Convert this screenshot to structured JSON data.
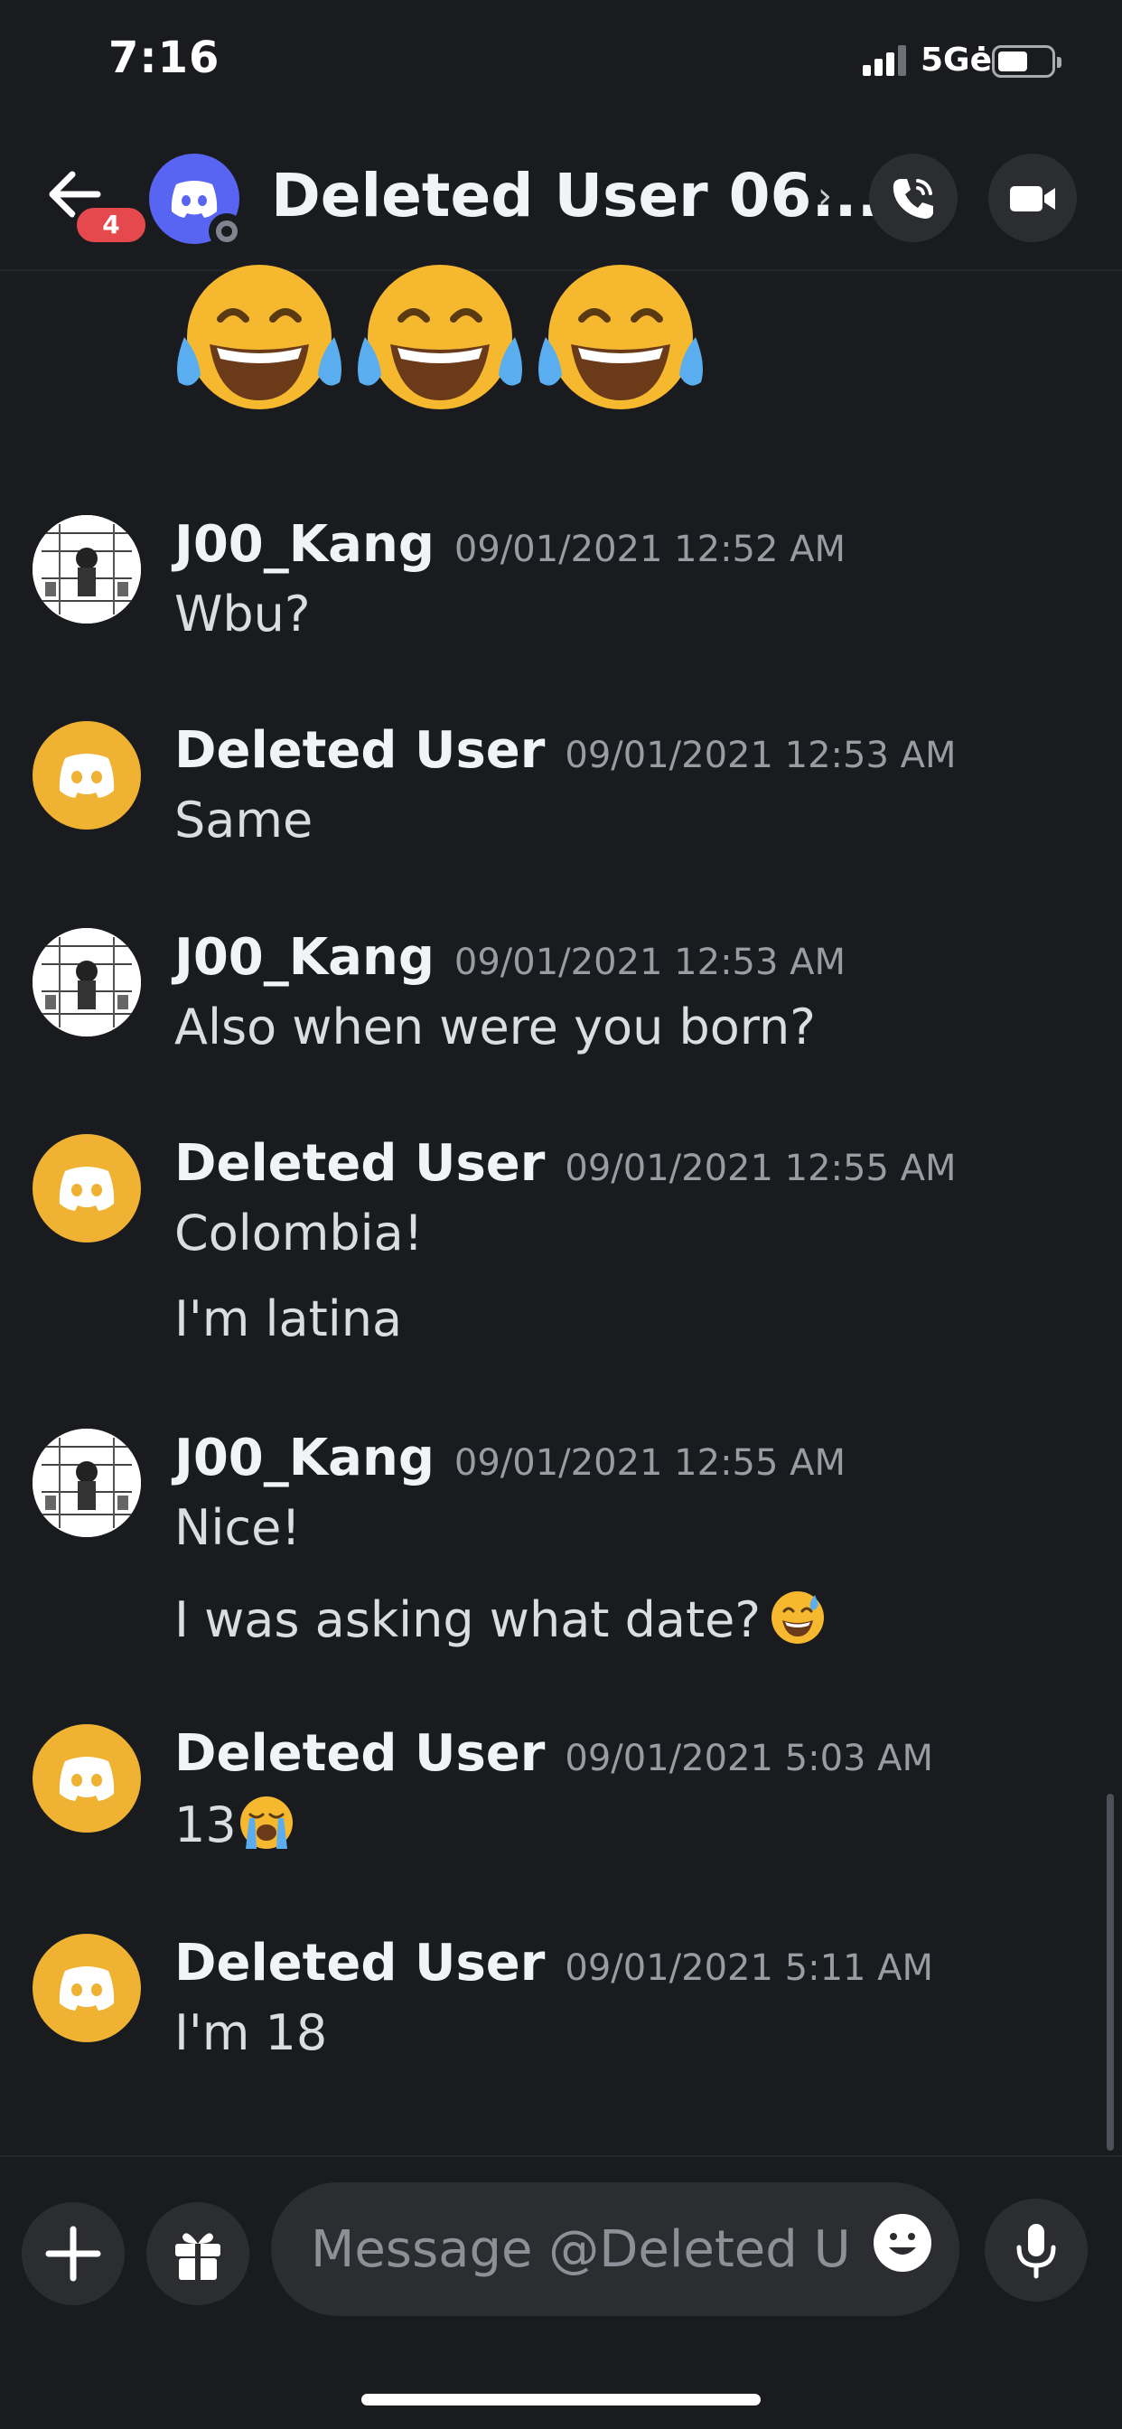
{
  "status_bar": {
    "time": "7:16",
    "network": "5Gė"
  },
  "header": {
    "unread_count": "4",
    "title": "Deleted User 06...",
    "chevron": "›",
    "icons": {
      "back": "arrow-left-icon",
      "call": "phone-icon",
      "video": "video-camera-icon"
    }
  },
  "messages": [
    {
      "author": "J00_Kang",
      "timestamp": "09/01/2021 12:52 AM",
      "lines": [
        "Wbu?"
      ]
    },
    {
      "author": "Deleted User",
      "timestamp": "09/01/2021 12:53 AM",
      "lines": [
        "Same"
      ]
    },
    {
      "author": "J00_Kang",
      "timestamp": "09/01/2021 12:53 AM",
      "lines": [
        "Also when were you born?"
      ]
    },
    {
      "author": "Deleted User",
      "timestamp": "09/01/2021 12:55 AM",
      "lines": [
        "Colombia!",
        "I'm latina"
      ]
    },
    {
      "author": "J00_Kang",
      "timestamp": "09/01/2021 12:55 AM",
      "lines": [
        "Nice!",
        "I was asking what date?"
      ]
    },
    {
      "author": "Deleted User",
      "timestamp": "09/01/2021 5:03 AM",
      "lines": [
        "13"
      ]
    },
    {
      "author": "Deleted User",
      "timestamp": "09/01/2021 5:11 AM",
      "lines": [
        "I'm 18"
      ]
    }
  ],
  "composer": {
    "placeholder": "Message @Deleted U..",
    "icons": {
      "add": "plus-icon",
      "gift": "gift-icon",
      "emoji": "smiley-icon",
      "mic": "microphone-icon"
    }
  },
  "colors": {
    "background": "#1a1b1f",
    "accent": "#5865f2",
    "deleted_avatar": "#f0b232",
    "badge": "#e5484d"
  }
}
